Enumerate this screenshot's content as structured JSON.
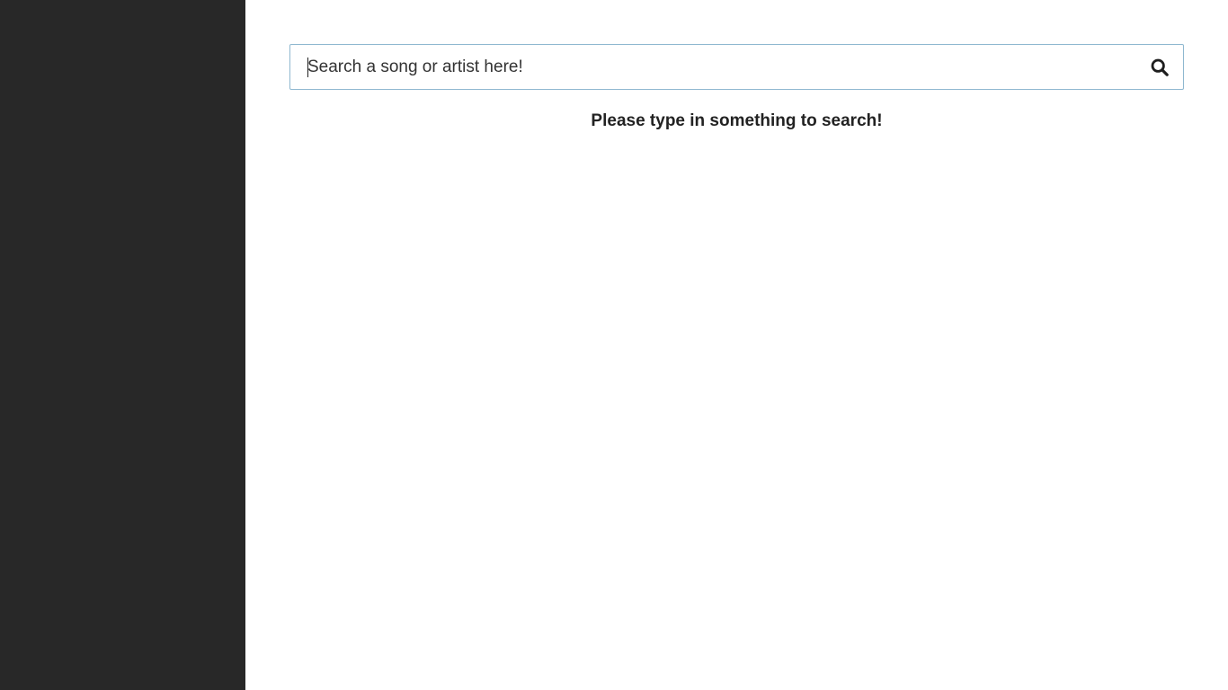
{
  "search": {
    "placeholder": "Search a song or artist here!",
    "value": "",
    "icon": "search-icon"
  },
  "main": {
    "empty_message": "Please type in something to search!"
  },
  "colors": {
    "sidebar_background": "#282828",
    "main_background": "#ffffff",
    "search_border": "#8fb8d0",
    "text": "#222222"
  }
}
